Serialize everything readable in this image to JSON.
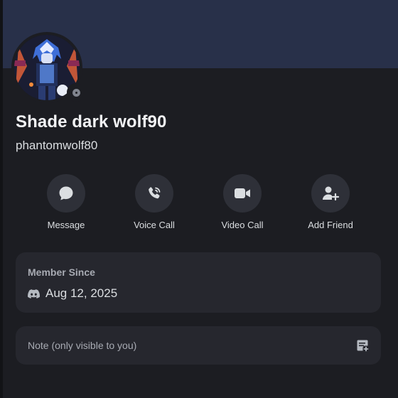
{
  "profile": {
    "display_name": "Shade dark wolf90",
    "username": "phantomwolf80",
    "status": "offline",
    "avatar_icon": "avatar-image"
  },
  "actions": [
    {
      "label": "Message",
      "icon": "chat-bubble-icon"
    },
    {
      "label": "Voice Call",
      "icon": "phone-icon"
    },
    {
      "label": "Video Call",
      "icon": "video-camera-icon"
    },
    {
      "label": "Add Friend",
      "icon": "add-friend-icon"
    }
  ],
  "member_since": {
    "title": "Member Since",
    "date": "Aug 12, 2025",
    "icon": "discord-logo-icon"
  },
  "note": {
    "placeholder": "Note (only visible to you)",
    "icon": "note-edit-icon"
  },
  "colors": {
    "background": "#1c1d22",
    "banner": "#283049",
    "card": "#26272e",
    "button": "#2e3038"
  }
}
